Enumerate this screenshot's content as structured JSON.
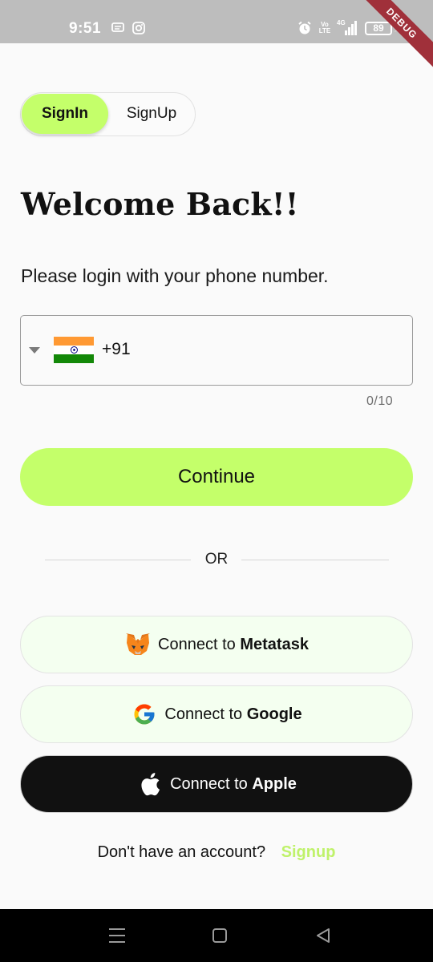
{
  "status_bar": {
    "time": "9:51",
    "volte_top": "Vo",
    "volte_bottom": "LTE",
    "network": "4G",
    "battery": "89",
    "debug_label": "DEBUG",
    "icons": [
      "message-icon",
      "instagram-icon",
      "alarm-icon",
      "signal-icon",
      "battery-icon",
      "charging-icon"
    ]
  },
  "toggle": {
    "signin_label": "SignIn",
    "signup_label": "SignUp",
    "active": "SignIn"
  },
  "title": "Welcome Back!!",
  "subtitle": "Please login with your phone number.",
  "phone": {
    "country_flag": "india-flag-icon",
    "dial_code": "+91",
    "value": "",
    "counter": "0/10"
  },
  "continue_label": "Continue",
  "or_label": "OR",
  "social": {
    "metamask": {
      "prefix": "Connect to ",
      "name": "Metatask",
      "icon": "metamask-fox-icon"
    },
    "google": {
      "prefix": "Connect to ",
      "name": "Google",
      "icon": "google-icon"
    },
    "apple": {
      "prefix": "Connect to ",
      "name": "Apple",
      "icon": "apple-icon"
    }
  },
  "footer": {
    "question": "Don't have an account?",
    "link": "Signup"
  },
  "colors": {
    "accent": "#c4ff6a",
    "social_light_bg": "#f4fff0",
    "apple_bg": "#111111",
    "signup_link": "#bff26a"
  }
}
